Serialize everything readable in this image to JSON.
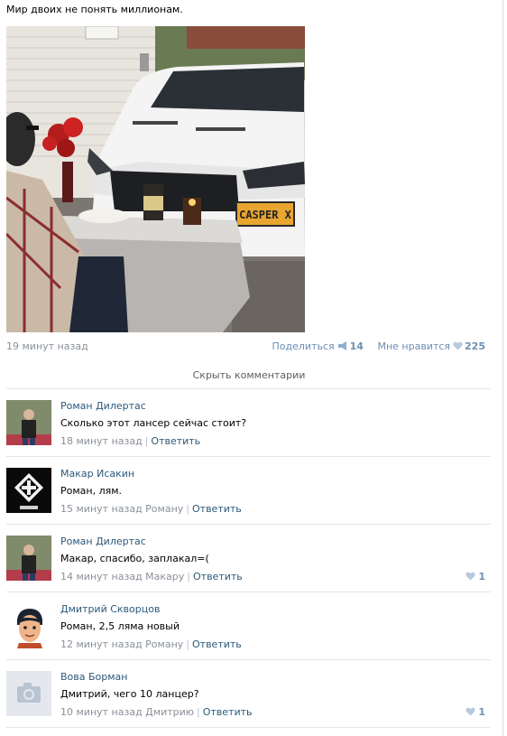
{
  "post": {
    "text": "Мир двоих не понять миллионам.",
    "time": "19 минут назад",
    "share_label": "Поделиться",
    "share_count": "14",
    "like_label": "Мне нравится",
    "like_count": "225",
    "plate_text": "CASPER X"
  },
  "hide_comments_label": "Скрыть комментарии",
  "comments": [
    {
      "author": "Роман Дилертас",
      "text": "Сколько этот лансер сейчас стоит?",
      "time": "18 минут назад",
      "reply": "Ответить",
      "likes": ""
    },
    {
      "author": "Макар Исакин",
      "text": "Роман, лям.",
      "time": "15 минут назад Роману",
      "reply": "Ответить",
      "likes": ""
    },
    {
      "author": "Роман Дилертас",
      "text": "Макар, спасибо, заплакал=(",
      "time": "14 минут назад Макару",
      "reply": "Ответить",
      "likes": "1"
    },
    {
      "author": "Дмитрий Скворцов",
      "text": "Роман, 2,5 ляма новый",
      "time": "12 минут назад Роману",
      "reply": "Ответить",
      "likes": ""
    },
    {
      "author": "Вова Борман",
      "text": "Дмитрий, чего 10 ланцер?",
      "time": "10 минут назад Дмитрию",
      "reply": "Ответить",
      "likes": "1"
    }
  ],
  "colors": {
    "link": "#2b587a",
    "muted": "#8a9099",
    "accent": "#6d8fb3"
  }
}
